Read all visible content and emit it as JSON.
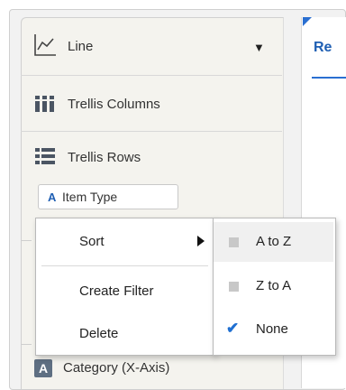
{
  "visualization": {
    "type_label": "Line",
    "dropdown_icon": "caret-down-icon",
    "icon": "line-chart-icon"
  },
  "drop_targets": {
    "trellis_columns": {
      "label": "Trellis Columns",
      "icon": "grid-columns-icon"
    },
    "trellis_rows": {
      "label": "Trellis Rows",
      "icon": "list-rows-icon"
    }
  },
  "pill": {
    "label": "Item Type",
    "icon": "attribute-icon",
    "icon_glyph": "A"
  },
  "context_menu": {
    "items": [
      {
        "label": "Sort",
        "has_submenu": true
      },
      {
        "label": "Create Filter"
      },
      {
        "label": "Delete"
      }
    ]
  },
  "sort_submenu": {
    "items": [
      {
        "label": "A to Z",
        "state": "unchecked",
        "highlighted": true
      },
      {
        "label": "Z to A",
        "state": "unchecked"
      },
      {
        "label": "None",
        "state": "checked"
      }
    ]
  },
  "category": {
    "label": "Category (X-Axis)",
    "icon_glyph": "A"
  },
  "right_panel": {
    "tab_label": "Re"
  },
  "colors": {
    "accent": "#1f6fd1",
    "panel_bg": "#f4f3ee",
    "category_icon_bg": "#5e6f82"
  }
}
